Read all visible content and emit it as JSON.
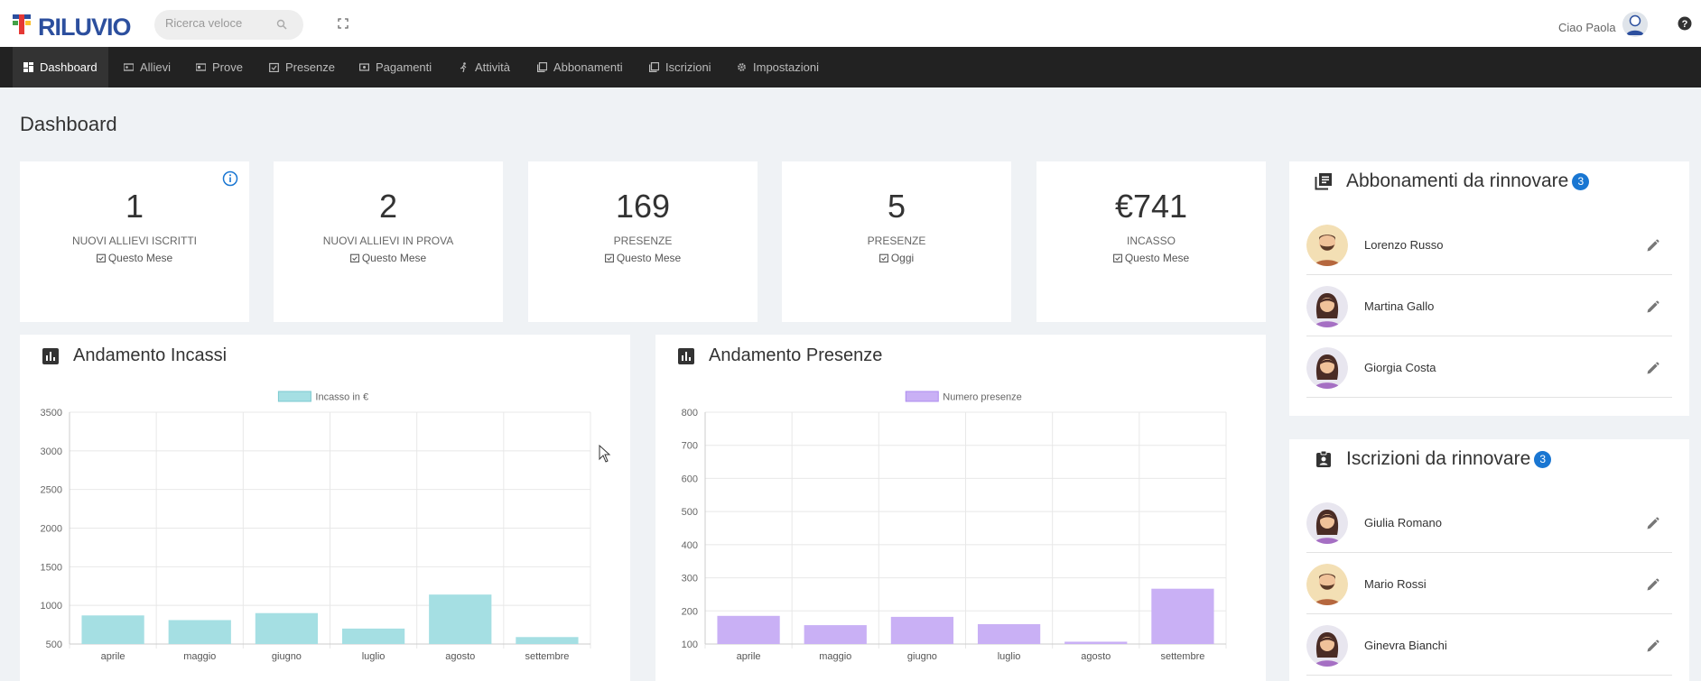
{
  "header": {
    "logo_text": "RILUVIO",
    "search_placeholder": "Ricerca veloce",
    "greeting": "Ciao Paola"
  },
  "nav": [
    {
      "label": "Dashboard",
      "icon": "dashboard-icon",
      "active": true
    },
    {
      "label": "Allievi",
      "icon": "students-icon"
    },
    {
      "label": "Prove",
      "icon": "trials-icon"
    },
    {
      "label": "Presenze",
      "icon": "calendar-check-icon"
    },
    {
      "label": "Pagamenti",
      "icon": "payment-icon"
    },
    {
      "label": "Attività",
      "icon": "activity-icon"
    },
    {
      "label": "Abbonamenti",
      "icon": "subscriptions-icon"
    },
    {
      "label": "Iscrizioni",
      "icon": "enrollments-icon"
    },
    {
      "label": "Impostazioni",
      "icon": "gear-icon"
    }
  ],
  "page_title": "Dashboard",
  "kpis": [
    {
      "value": "1",
      "label": "NUOVI ALLIEVI ISCRITTI",
      "period": "Questo Mese"
    },
    {
      "value": "2",
      "label": "NUOVI ALLIEVI IN PROVA",
      "period": "Questo Mese"
    },
    {
      "value": "169",
      "label": "PRESENZE",
      "period": "Questo Mese"
    },
    {
      "value": "5",
      "label": "PRESENZE",
      "period": "Oggi"
    },
    {
      "value": "€741",
      "label": "INCASSO",
      "period": "Questo Mese"
    }
  ],
  "panels": {
    "incassi_title": "Andamento Incassi",
    "presenze_title": "Andamento Presenze"
  },
  "chart_data": [
    {
      "type": "bar",
      "title": "Andamento Incassi",
      "categories": [
        "aprile",
        "maggio",
        "giugno",
        "luglio",
        "agosto",
        "settembre"
      ],
      "series": [
        {
          "name": "Incasso in €",
          "values": [
            870,
            810,
            900,
            700,
            1140,
            590
          ]
        }
      ],
      "ylim": [
        500,
        3500
      ],
      "yticks": [
        500,
        1000,
        1500,
        2000,
        2500,
        3000,
        3500
      ],
      "grid": true,
      "legend": "top",
      "color": "#a5dfe3"
    },
    {
      "type": "bar",
      "title": "Andamento Presenze",
      "categories": [
        "aprile",
        "maggio",
        "giugno",
        "luglio",
        "agosto",
        "settembre"
      ],
      "series": [
        {
          "name": "Numero presenze",
          "values": [
            185,
            157,
            182,
            160,
            107,
            267
          ]
        }
      ],
      "ylim": [
        100,
        800
      ],
      "yticks": [
        100,
        200,
        300,
        400,
        500,
        600,
        700,
        800
      ],
      "grid": true,
      "legend": "top",
      "color": "#c9b0f5"
    }
  ],
  "abbonamenti": {
    "title": "Abbonamenti da rinnovare",
    "count": "3",
    "people": [
      {
        "name": "Lorenzo Russo",
        "gender": "m"
      },
      {
        "name": "Martina Gallo",
        "gender": "f"
      },
      {
        "name": "Giorgia Costa",
        "gender": "f"
      }
    ]
  },
  "iscrizioni": {
    "title": "Iscrizioni da rinnovare",
    "count": "3",
    "people": [
      {
        "name": "Giulia Romano",
        "gender": "f"
      },
      {
        "name": "Mario Rossi",
        "gender": "m"
      },
      {
        "name": "Ginevra Bianchi",
        "gender": "f"
      }
    ]
  }
}
